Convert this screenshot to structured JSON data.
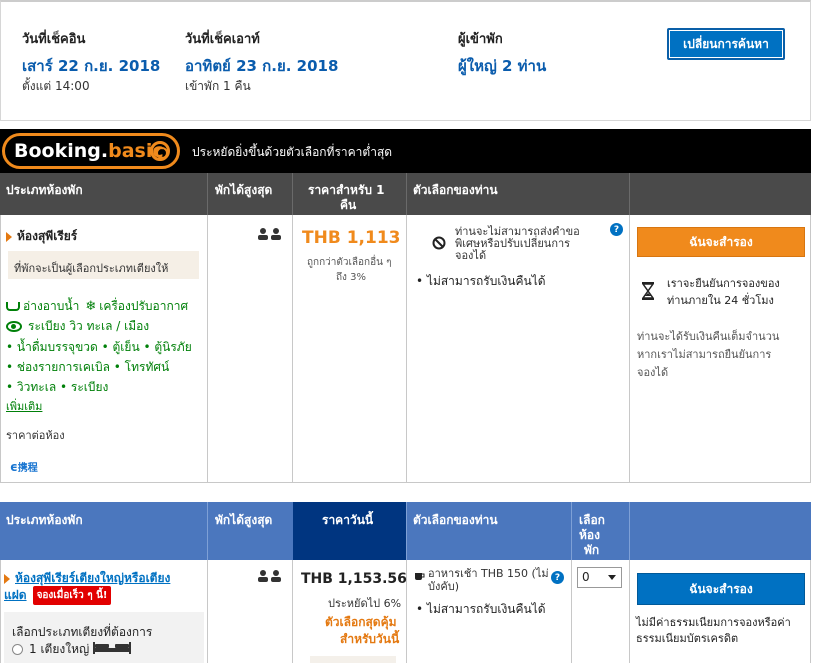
{
  "search": {
    "checkin_label": "วันที่เช็คอิน",
    "checkin_date": "เสาร์ 22 ก.ย. 2018",
    "checkin_time": "ตั้งแต่ 14:00",
    "checkout_label": "วันที่เช็คเอาท์",
    "checkout_date": "อาทิตย์ 23 ก.ย. 2018",
    "nights": "เข้าพัก 1 คืน",
    "guests_label": "ผู้เข้าพัก",
    "guests_value": "ผู้ใหญ่ 2 ท่าน",
    "change_button": "เปลี่ยนการค้นหา"
  },
  "banner": {
    "logo_part1": "Booking.",
    "logo_part2": "basic",
    "text": "ประหยัดยิ่งขึ้นด้วยตัวเลือกที่ราคาต่ำสุด"
  },
  "table1": {
    "headers": {
      "room_type": "ประเภทห้องพัก",
      "max_guests": "พักได้สูงสุด",
      "price_line1": "ราคาสำหรับ 1",
      "price_line2": "คืน",
      "options": "ตัวเลือกของท่าน"
    },
    "room": {
      "name": "ห้องสุพีเรียร์",
      "note": "ที่พักจะเป็นผู้เลือกประเภทเตียงให้",
      "amenity1": "อ่างอาบน้ำ",
      "amenity2": "เครื่องปรับอากาศ",
      "amenity3": "ระเบียง วิว ทะเล / เมือง",
      "features": [
        "• น้ำดื่มบรรจุขวด • ตู้เย็น • ตู้นิรภัย",
        "• ช่องรายการเคเบิล • โทรทัศน์",
        "• วิวทะเล • ระเบียง"
      ],
      "more_link": "เพิ่มเติม",
      "price_per_room": "ราคาต่อห้อง",
      "ctrip_label": "携程",
      "price": "THB 1,113",
      "discount_line1": "ถูกกว่าตัวเลือกอื่น ๆ",
      "discount_line2": "ถึง 3%",
      "option1_line1": "ท่านจะไม่สามารถส่งคำขอ",
      "option1_line2": "พิเศษหรือปรับเปลี่ยนการ",
      "option1_line3": "จองได้",
      "option2": "ไม่สามารถรับเงินคืนได้",
      "book_button": "ฉันจะสำรอง",
      "confirm_line1": "เราจะยืนยันการจองของ",
      "confirm_line2": "ท่านภายใน 24 ชั่วโมง",
      "refund_line1": "ท่านจะได้รับเงินคืนเต็มจำนวน",
      "refund_line2": "หากเราไม่สามารถยืนยันการ",
      "refund_line3": "จองได้"
    }
  },
  "table2": {
    "headers": {
      "room_type": "ประเภทห้องพัก",
      "max_guests": "พักได้สูงสุด",
      "price_today": "ราคาวันนี้",
      "options": "ตัวเลือกของท่าน",
      "select_line1": "เลือก",
      "select_line2": "ห้อง",
      "select_line3": "พัก"
    },
    "room": {
      "name_line1": "ห้องสุพีเรียร์เตียงใหญ่หรือเตียง",
      "name_line2": "แฝด",
      "badge": "จองเมื่อเร็ว ๆ นี้!",
      "bed_choice_label": "เลือกประเภทเตียงที่ต้องการ",
      "bed_option1": "1 เตียงใหญ่",
      "price": "THB 1,153.56",
      "savings": "ประหยัดไป 6%",
      "deal_line1": "ตัวเลือกสุดคุ้ม",
      "deal_line2": "สำหรับวันนี้",
      "breakfast_line1": "อาหารเช้า THB 150 (ไม่",
      "breakfast_line2": "บังคับ)",
      "no_refund": "ไม่สามารถรับเงินคืนได้",
      "select_value": "0",
      "book_button": "ฉันจะสำรอง",
      "no_fee_line1": "ไม่มีค่าธรรมเนียมการจองหรือค่า",
      "no_fee_line2": "ธรรมเนียมบัตรเครดิต"
    }
  },
  "colors": {
    "blue": "#0071c2",
    "orange": "#f08a1c",
    "green": "#008009",
    "dark_header": "#4a4a4a",
    "blue_header": "#4b77be",
    "navy_header": "#003580"
  }
}
